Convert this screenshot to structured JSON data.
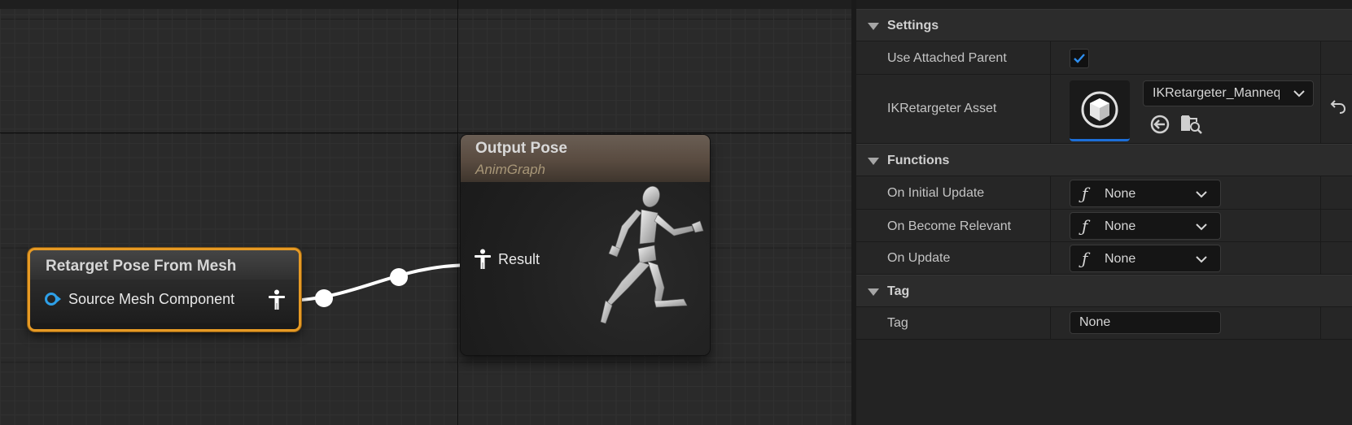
{
  "graph": {
    "retarget_node": {
      "title": "Retarget Pose From Mesh",
      "source_pin_label": "Source Mesh Component"
    },
    "output_node": {
      "title": "Output Pose",
      "subtitle": "AnimGraph",
      "result_pin_label": "Result"
    }
  },
  "details": {
    "sections": {
      "settings": {
        "title": "Settings"
      },
      "functions": {
        "title": "Functions"
      },
      "tag": {
        "title": "Tag"
      }
    },
    "settings": {
      "use_attached_parent": {
        "label": "Use Attached Parent",
        "checked": true
      },
      "ik_retargeter_asset": {
        "label": "IKRetargeter Asset",
        "value": "IKRetargeter_Mannequin"
      }
    },
    "functions": {
      "on_initial_update": {
        "label": "On Initial Update",
        "value": "None"
      },
      "on_become_relevant": {
        "label": "On Become Relevant",
        "value": "None"
      },
      "on_update": {
        "label": "On Update",
        "value": "None"
      }
    },
    "tag": {
      "label": "Tag",
      "value": "None"
    }
  },
  "colors": {
    "selection_outline": "#e69a25",
    "accent_blue": "#1d6fd8",
    "pin_blue": "#2ea0e8"
  },
  "icons": [
    "function-icon",
    "chevron-down-icon",
    "checkmark-icon",
    "browse-to-asset-icon",
    "find-in-browser-icon",
    "reset-to-default-icon",
    "pose-pin-icon",
    "component-pin-icon"
  ]
}
